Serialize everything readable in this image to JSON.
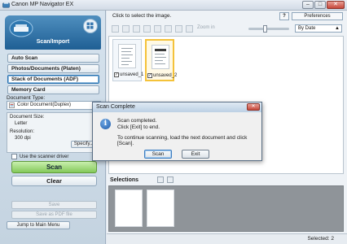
{
  "window": {
    "title": "Canon MP Navigator EX",
    "controls": {
      "minimize": "–",
      "maximize": "□",
      "close": "✕"
    }
  },
  "sidebar": {
    "header_label": "Scan/Import",
    "modes": [
      {
        "label": "Auto Scan",
        "active": false
      },
      {
        "label": "Photos/Documents (Platen)",
        "active": false
      },
      {
        "label": "Stack of Documents (ADF)",
        "active": true
      },
      {
        "label": "Memory Card",
        "active": false
      }
    ],
    "document_type_label": "Document Type:",
    "document_type_value": "Color Document(Duplex)",
    "document_size_label": "Document Size:",
    "document_size_value": "Letter",
    "resolution_label": "Resolution:",
    "resolution_value": "300 dpi",
    "specify_label": "Specify...",
    "use_driver_label": "Use the scanner driver",
    "scan_label": "Scan",
    "clear_label": "Clear",
    "save_label": "Save",
    "save_pdf_label": "Save as PDF file",
    "jump_label": "Jump to Main Menu"
  },
  "main": {
    "instruction": "Click to select the image.",
    "help_label": "?",
    "preferences_label": "Preferences",
    "zoom_label": "Zoom in",
    "sort_value": "By Date",
    "thumbnails": [
      {
        "label": "unsaved_1",
        "checked": true
      },
      {
        "label": "unsaved_2",
        "checked": true
      }
    ],
    "selections_label": "Selections",
    "status_text": "Selected: 2"
  },
  "dialog": {
    "title": "Scan Complete",
    "line1": "Scan completed.",
    "line2": "Click [Exit] to end.",
    "line3": "To continue scanning, load the next document and click [Scan].",
    "scan_button": "Scan",
    "exit_button": "Exit",
    "close_glyph": "✕",
    "info_glyph": "i"
  },
  "colors": {
    "accent": "#1f5f94",
    "scan_button": "#84c95a",
    "selected_thumb": "#f4c23a",
    "selections_bg": "#8f9499"
  }
}
